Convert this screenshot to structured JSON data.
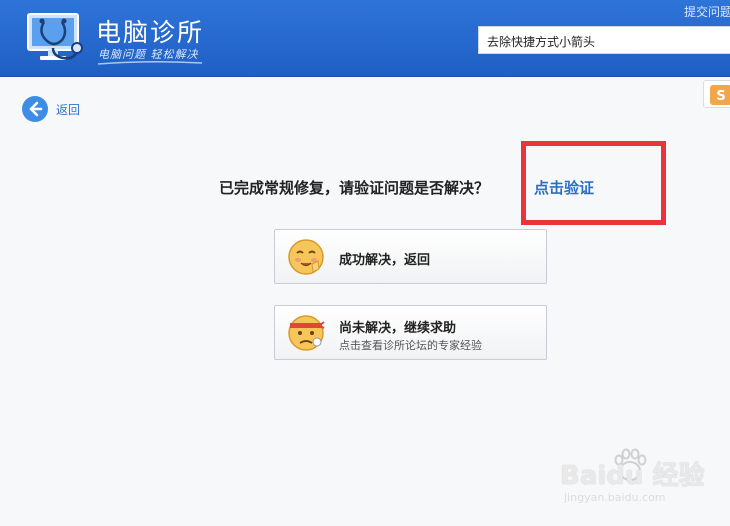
{
  "header": {
    "title": "电脑诊所",
    "slogan": "电脑问题 轻松解决",
    "top_link": "提交问题",
    "search_value": "去除快捷方式小箭头"
  },
  "nav": {
    "back_label": "返回"
  },
  "main": {
    "prompt": "已完成常规修复，请验证问题是否解决？",
    "verify_link": "点击验证",
    "options": [
      {
        "title": "成功解决，返回",
        "subtitle": ""
      },
      {
        "title": "尚未解决，继续求助",
        "subtitle": "点击查看诊所论坛的专家经验"
      }
    ]
  },
  "watermark": {
    "brand": "Baidu 经验",
    "url": "jingyan.baidu.com"
  },
  "colors": {
    "header_blue": "#2f74d8",
    "link_blue": "#2b6fc1",
    "highlight_red": "#e8343a"
  },
  "icons": [
    "monitor-stethoscope-icon",
    "back-arrow-icon",
    "happy-face-icon",
    "worried-face-icon",
    "baidu-paw-icon",
    "side-badge-icon"
  ]
}
